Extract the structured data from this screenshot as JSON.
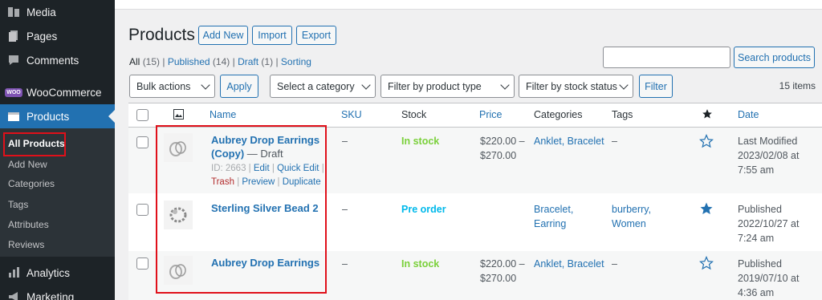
{
  "sidebar": {
    "items": [
      {
        "label": "Media",
        "icon": "media-icon"
      },
      {
        "label": "Pages",
        "icon": "pages-icon"
      },
      {
        "label": "Comments",
        "icon": "comments-icon"
      },
      {
        "label": "WooCommerce",
        "icon": "woocommerce-icon",
        "badge": "WOO"
      },
      {
        "label": "Products",
        "icon": "products-icon",
        "active": true
      },
      {
        "label": "Analytics",
        "icon": "analytics-icon"
      },
      {
        "label": "Marketing",
        "icon": "marketing-icon"
      }
    ],
    "submenu": [
      "All Products",
      "Add New",
      "Categories",
      "Tags",
      "Attributes",
      "Reviews"
    ]
  },
  "header": {
    "title": "Products",
    "add_new": "Add New",
    "import": "Import",
    "export": "Export"
  },
  "views": {
    "all": "All",
    "all_count": "(15)",
    "published": "Published",
    "published_count": "(14)",
    "draft": "Draft",
    "draft_count": "(1)",
    "sorting": "Sorting",
    "sep": "|"
  },
  "search": {
    "button": "Search products",
    "value": ""
  },
  "filters": {
    "bulk_actions": "Bulk actions",
    "apply": "Apply",
    "category": "Select a category",
    "product_type": "Filter by product type",
    "stock_status": "Filter by stock status",
    "filter": "Filter",
    "items_count": "15 items"
  },
  "table": {
    "columns": {
      "name": "Name",
      "sku": "SKU",
      "stock": "Stock",
      "price": "Price",
      "categories": "Categories",
      "tags": "Tags",
      "date": "Date"
    },
    "rows": [
      {
        "name_line1": "Aubrey Drop Earrings",
        "name_line2": "(Copy)",
        "state": " — Draft",
        "id_text": "ID: 2663 |",
        "actions": {
          "edit": "Edit",
          "quick_edit": "Quick Edit",
          "trash": "Trash",
          "preview": "Preview",
          "duplicate": "Duplicate",
          "sep": "|"
        },
        "sku": "–",
        "stock": "In stock",
        "price_line1": "$220.00 –",
        "price_line2": "$270.00",
        "categories": "Anklet, Bracelet",
        "tags": "–",
        "featured": false,
        "date_line1": "Last Modified",
        "date_line2": "2023/02/08 at",
        "date_line3": "7:55 am"
      },
      {
        "name_line1": "Sterling Silver Bead 2",
        "sku": "–",
        "stock": "Pre order",
        "categories_line1": "Bracelet,",
        "categories_line2": "Earring",
        "tags_line1": "burberry,",
        "tags_line2": "Women",
        "featured": true,
        "date_line1": "Published",
        "date_line2": "2022/10/27 at",
        "date_line3": "7:24 am"
      },
      {
        "name_line1": "Aubrey Drop Earrings",
        "sku": "–",
        "stock": "In stock",
        "price_line1": "$220.00 –",
        "price_line2": "$270.00",
        "categories": "Anklet, Bracelet",
        "tags": "–",
        "featured": false,
        "date_line1": "Published",
        "date_line2": "2019/07/10 at",
        "date_line3": "4:36 am"
      }
    ]
  },
  "colors": {
    "accent": "#2271b1",
    "sidebar": "#1d2327",
    "in_stock": "#7ad03a",
    "pre_order": "#00b9eb",
    "highlight": "#e0101a"
  }
}
